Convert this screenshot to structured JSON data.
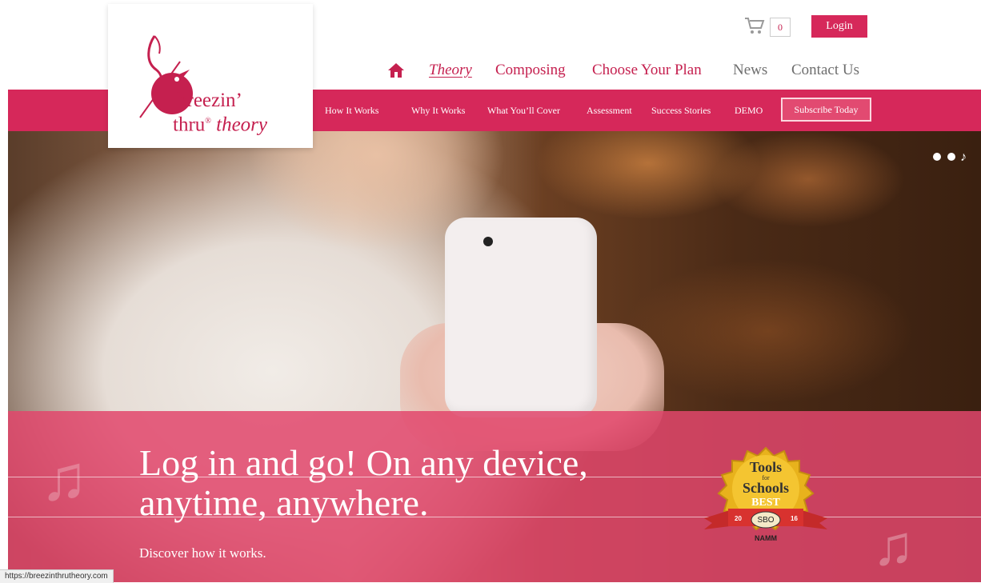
{
  "header": {
    "logo": {
      "line1": "breezin’",
      "line2_a": "thru",
      "line2_reg": "®",
      "line2_b": "theory"
    },
    "cart_count": "0",
    "login_label": "Login",
    "nav": [
      {
        "label": "Theory"
      },
      {
        "label": "Composing"
      },
      {
        "label": "Choose Your Plan"
      },
      {
        "label": "News"
      },
      {
        "label": "Contact Us"
      }
    ]
  },
  "subnav": {
    "items": [
      {
        "label": "How It Works"
      },
      {
        "label": "Why It Works"
      },
      {
        "label": "What You’ll Cover"
      },
      {
        "label": "Assessment"
      },
      {
        "label": "Success Stories"
      },
      {
        "label": "DEMO"
      }
    ],
    "subscribe_label": "Subscribe Today"
  },
  "hero": {
    "headline_line1": "Log in and go! On any device,",
    "headline_line2": "anytime, anywhere.",
    "subline": "Discover how it works.",
    "award": {
      "line1": "Tools",
      "line2": "for",
      "line3": "Schools",
      "best": "BEST",
      "sbo": "SBO",
      "namm": "NAMM",
      "year_left": "20",
      "year_right": "16"
    }
  },
  "status_bar": {
    "url": "https://breezinthrutheory.com"
  },
  "colors": {
    "brand": "#c5204f",
    "bar": "#d6285a",
    "nav_gray": "#6e6e6e"
  },
  "icons": [
    "cart-icon",
    "home-icon",
    "music-note-icon"
  ]
}
